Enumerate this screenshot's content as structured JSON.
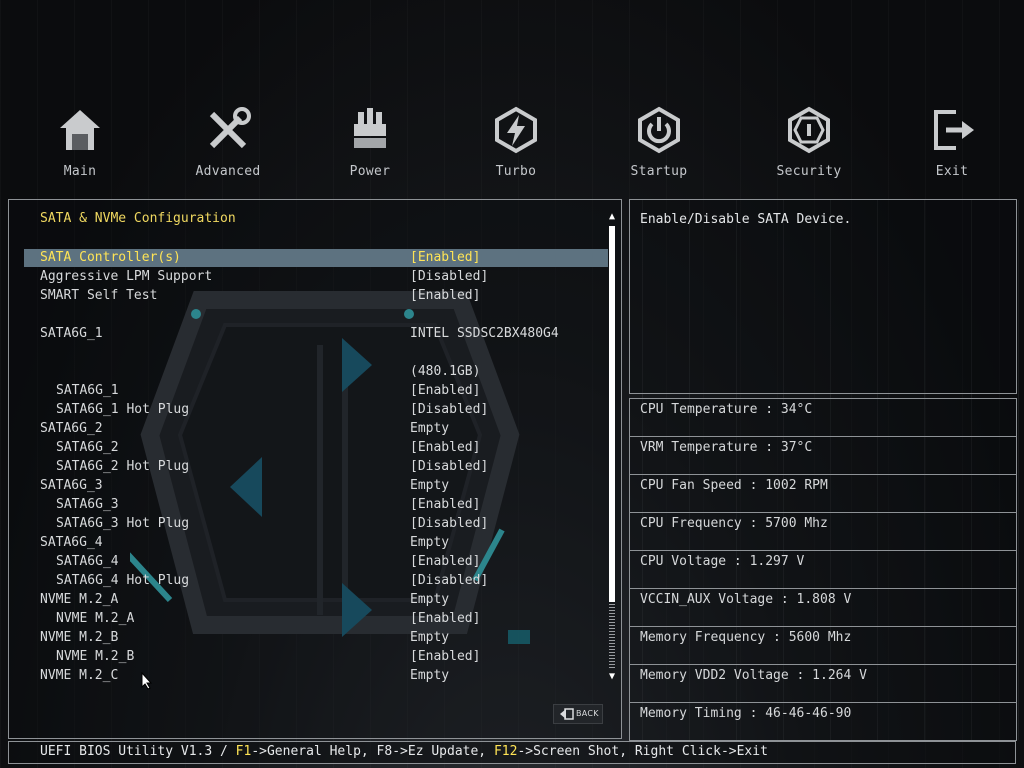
{
  "nav": [
    {
      "label": "Main",
      "icon": "house-icon"
    },
    {
      "label": "Advanced",
      "icon": "tools-icon"
    },
    {
      "label": "Power",
      "icon": "power-module-icon"
    },
    {
      "label": "Turbo",
      "icon": "lightning-icon"
    },
    {
      "label": "Startup",
      "icon": "power-button-icon"
    },
    {
      "label": "Security",
      "icon": "shield-icon"
    },
    {
      "label": "Exit",
      "icon": "exit-door-icon"
    }
  ],
  "section_title": "SATA & NVMe Configuration",
  "rows": [
    {
      "label": "SATA Controller(s)",
      "value": "[Enabled]"
    },
    {
      "label": "Aggressive LPM Support",
      "value": "[Disabled]"
    },
    {
      "label": "SMART Self Test",
      "value": "[Enabled]"
    },
    {
      "label": "SATA6G_1",
      "value": "INTEL SSDSC2BX480G4"
    },
    {
      "label": "",
      "value": "(480.1GB)"
    },
    {
      "label": "SATA6G_1",
      "value": "[Enabled]"
    },
    {
      "label": "SATA6G_1 Hot Plug",
      "value": "[Disabled]"
    },
    {
      "label": "SATA6G_2",
      "value": "Empty"
    },
    {
      "label": "SATA6G_2",
      "value": "[Enabled]"
    },
    {
      "label": "SATA6G_2 Hot Plug",
      "value": "[Disabled]"
    },
    {
      "label": "SATA6G_3",
      "value": "Empty"
    },
    {
      "label": "SATA6G_3",
      "value": "[Enabled]"
    },
    {
      "label": "SATA6G_3 Hot Plug",
      "value": "[Disabled]"
    },
    {
      "label": "SATA6G_4",
      "value": "Empty"
    },
    {
      "label": "SATA6G_4",
      "value": "[Enabled]"
    },
    {
      "label": "SATA6G_4 Hot Plug",
      "value": "[Disabled]"
    },
    {
      "label": "NVME M.2_A",
      "value": "Empty"
    },
    {
      "label": "NVME M.2_A",
      "value": "[Enabled]"
    },
    {
      "label": "NVME M.2_B",
      "value": "Empty"
    },
    {
      "label": "NVME M.2_B",
      "value": "[Enabled]"
    },
    {
      "label": "NVME M.2_C",
      "value": "Empty"
    }
  ],
  "help_text": "Enable/Disable SATA Device.",
  "stats": [
    "CPU Temperature : 34°C",
    "VRM Temperature : 37°C",
    "CPU Fan Speed : 1002 RPM",
    "CPU Frequency : 5700 Mhz",
    "CPU Voltage : 1.297 V",
    "VCCIN_AUX Voltage : 1.808 V",
    "Memory Frequency : 5600 Mhz",
    "Memory VDD2 Voltage : 1.264 V",
    "Memory Timing : 46-46-46-90"
  ],
  "back_label": "BACK",
  "footer": {
    "prefix": "UEFI BIOS Utility V1.3 / ",
    "k1": "F1",
    "t1": "->General Help, F8->Ez Update, ",
    "k2": "F12",
    "t2": "->Screen Shot, Right Click->Exit"
  },
  "colors": {
    "accent_yellow": "#ffe455",
    "selected_row": "#5d7280",
    "art_cyan": "#3fc6d0",
    "border": "#8e9296"
  }
}
